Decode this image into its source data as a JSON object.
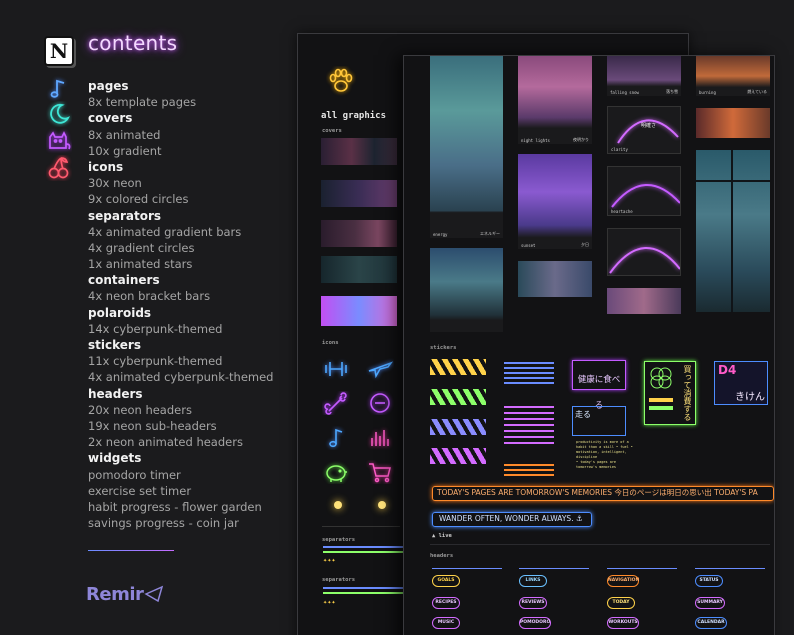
{
  "app": {
    "title": "contents",
    "logo_glyph": "N",
    "brand": "Remir"
  },
  "contents": [
    {
      "heading": "pages",
      "icon": "music-note-icon",
      "items": [
        "8x template pages"
      ]
    },
    {
      "heading": "covers",
      "icon": "moon-icon",
      "items": [
        "8x animated",
        "10x gradient"
      ]
    },
    {
      "heading": "icons",
      "icon": "cat-icon",
      "items": [
        "30x neon",
        "9x colored circles"
      ]
    },
    {
      "heading": "separators",
      "icon": "cherries-icon",
      "items": [
        "4x animated gradient bars",
        "4x gradient circles",
        "1x animated stars"
      ]
    },
    {
      "heading": "containers",
      "items": [
        "4x neon bracket bars"
      ]
    },
    {
      "heading": "polaroids",
      "items": [
        "14x cyberpunk-themed"
      ]
    },
    {
      "heading": "stickers",
      "items": [
        "11x cyberpunk-themed",
        "4x animated cyberpunk-themed"
      ]
    },
    {
      "heading": "headers",
      "items": [
        "20x neon headers",
        "19x neon sub-headers",
        "2x neon animated headers"
      ]
    },
    {
      "heading": "widgets",
      "items": [
        "pomodoro timer",
        "exercise set timer",
        "habit progress - flower garden",
        "savings progress - coin jar"
      ]
    }
  ],
  "back_page": {
    "title": "all graphics",
    "covers_label": "covers",
    "icons_label": "icons",
    "separators_label_1": "separators",
    "separators_label_2": "separators"
  },
  "front_page": {
    "polaroid_captions": {
      "energy": "energy",
      "energy_jp": "エネルギー",
      "night_lights": "night lights",
      "night_lights_jp": "夜明かり",
      "sunset": "sunset",
      "sunset_jp": "夕日",
      "falling_snow": "falling snow",
      "falling_snow_jp": "落ち雪",
      "burning": "burning",
      "burning_jp": "燃えている",
      "clarity": "clarity",
      "clarity_jp": "明確さ",
      "heartache": "heartache",
      "heartache_jp": "心痛"
    },
    "stickers_label": "stickers",
    "sticker_eat": "健康に食べる",
    "sticker_buy": "買って消費する",
    "sticker_d4": "D4",
    "sticker_kiken": "きけん",
    "sticker_run": "走る",
    "sticker_note": "productivity is more of a habit than a skill • fuel • motivation, intelligent, discipline",
    "sticker_note_sub": "• today's pages are tomorrow's memories",
    "banner_orange": "TODAY'S PAGES ARE TOMORROW'S MEMORIES 今日のページは明日の思い出  TODAY'S PA",
    "banner_blue": "WANDER OFTEN, WONDER ALWAYS.",
    "live_label": "live",
    "headers_label": "headers",
    "header_pills": [
      [
        "GOALS",
        "LINKS",
        "NAVIGATION",
        "STATUS"
      ],
      [
        "RECIPES",
        "REVIEWS",
        "TODAY",
        "SUMMARY"
      ],
      [
        "MUSIC",
        "POMODORO",
        "WORKOUTS",
        "CALENDAR"
      ]
    ]
  },
  "colors": {
    "neon_pink": "#d36bff",
    "neon_blue": "#4d8dff",
    "neon_orange": "#ff8a2a",
    "neon_yellow": "#ffd24a",
    "neon_green": "#8dff6a",
    "background": "#1b1b1d"
  }
}
